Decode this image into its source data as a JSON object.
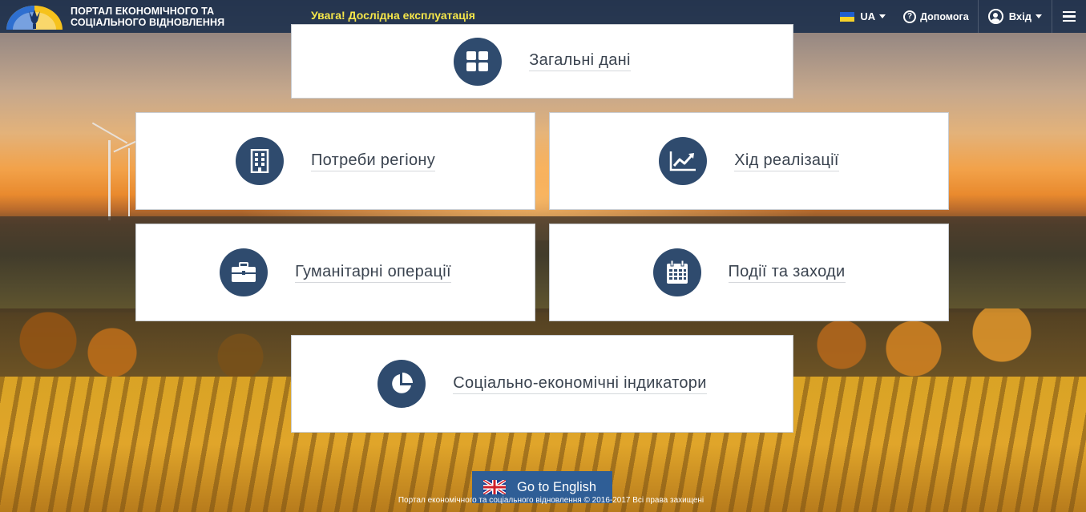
{
  "header": {
    "portal_title_line1": "ПОРТАЛ ЕКОНОМІЧНОГО ТА",
    "portal_title_line2": "СОЦІАЛЬНОГО ВІДНОВЛЕННЯ",
    "warning": "Увага! Дослідна експлуатація",
    "language": "UA",
    "help_label": "Допомога",
    "login_label": "Вхід"
  },
  "cards": {
    "general": "Загальні дані",
    "needs": "Потреби регіону",
    "progress": "Хід реалізації",
    "humanitarian": "Гуманітарні операції",
    "events": "Події та заходи",
    "indicators": "Соціально-економічні індикатори"
  },
  "bottom": {
    "go_english": "Go to English",
    "footer": "Портал економічного та соціального відновлення © 2016-2017 Всі права захищені"
  },
  "colors": {
    "header_bg": "#192d4b",
    "warning_text": "#f5e64a",
    "icon_circle": "#2f4b6e",
    "english_button": "#2f5e96"
  },
  "icons": {
    "general": "grid-icon",
    "needs": "building-icon",
    "progress": "chart-line-icon",
    "humanitarian": "briefcase-icon",
    "events": "calendar-icon",
    "indicators": "pie-chart-icon"
  }
}
